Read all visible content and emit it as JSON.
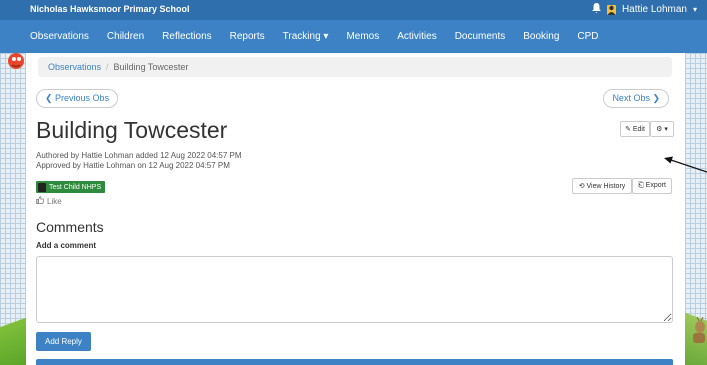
{
  "header": {
    "school_name": "Nicholas Hawksmoor Primary School",
    "user_name": "Hattie Lohman",
    "user_caret": "▾"
  },
  "nav": {
    "items": [
      {
        "label": "Observations"
      },
      {
        "label": "Children"
      },
      {
        "label": "Reflections"
      },
      {
        "label": "Reports"
      },
      {
        "label": "Tracking ▾"
      },
      {
        "label": "Memos"
      },
      {
        "label": "Activities"
      },
      {
        "label": "Documents"
      },
      {
        "label": "Booking"
      },
      {
        "label": "CPD"
      }
    ]
  },
  "breadcrumb": {
    "root": "Observations",
    "separator": "/",
    "current": "Building Towcester"
  },
  "pager": {
    "previous": "❮ Previous Obs",
    "next": "Next Obs ❯"
  },
  "observation": {
    "title": "Building Towcester",
    "authored": "Authored by Hattie Lohman added 12 Aug 2022 04:57 PM",
    "approved": "Approved by Hattie Lohman on 12 Aug 2022 04:57 PM",
    "child_tag": "Test Child NHPS",
    "like_label": "Like"
  },
  "actions": {
    "edit": "✎ Edit",
    "settings": "⚙ ▾",
    "view_history": "⟲ View History",
    "export": "⎗ Export"
  },
  "comments": {
    "heading": "Comments",
    "add_label": "Add a comment",
    "textarea_value": "",
    "submit": "Add Reply"
  },
  "colors": {
    "brand_bar": "#2f6fad",
    "nav_bar": "#3c82c4",
    "tag_green": "#2e8a3c"
  }
}
